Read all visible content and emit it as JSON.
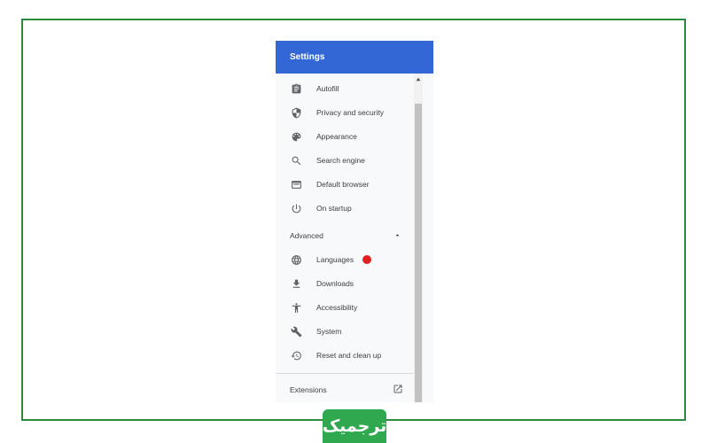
{
  "header": {
    "title": "Settings"
  },
  "menu": {
    "items": [
      {
        "label": "Autofill",
        "icon": "clipboard-icon"
      },
      {
        "label": "Privacy and security",
        "icon": "shield-icon"
      },
      {
        "label": "Appearance",
        "icon": "palette-icon"
      },
      {
        "label": "Search engine",
        "icon": "search-icon"
      },
      {
        "label": "Default browser",
        "icon": "browser-window-icon"
      },
      {
        "label": "On startup",
        "icon": "power-icon"
      }
    ],
    "advanced_label": "Advanced",
    "advanced_items": [
      {
        "label": "Languages",
        "icon": "globe-icon"
      },
      {
        "label": "Downloads",
        "icon": "download-icon"
      },
      {
        "label": "Accessibility",
        "icon": "accessibility-icon"
      },
      {
        "label": "System",
        "icon": "wrench-icon"
      },
      {
        "label": "Reset and clean up",
        "icon": "history-icon"
      }
    ],
    "extensions_label": "Extensions"
  },
  "annotation": {
    "dot_color": "#e02020"
  },
  "logo": {
    "text": "ترجمیک",
    "color": "#2fa84f"
  },
  "colors": {
    "header": "#3367d6",
    "frame": "#2e8b3e"
  }
}
